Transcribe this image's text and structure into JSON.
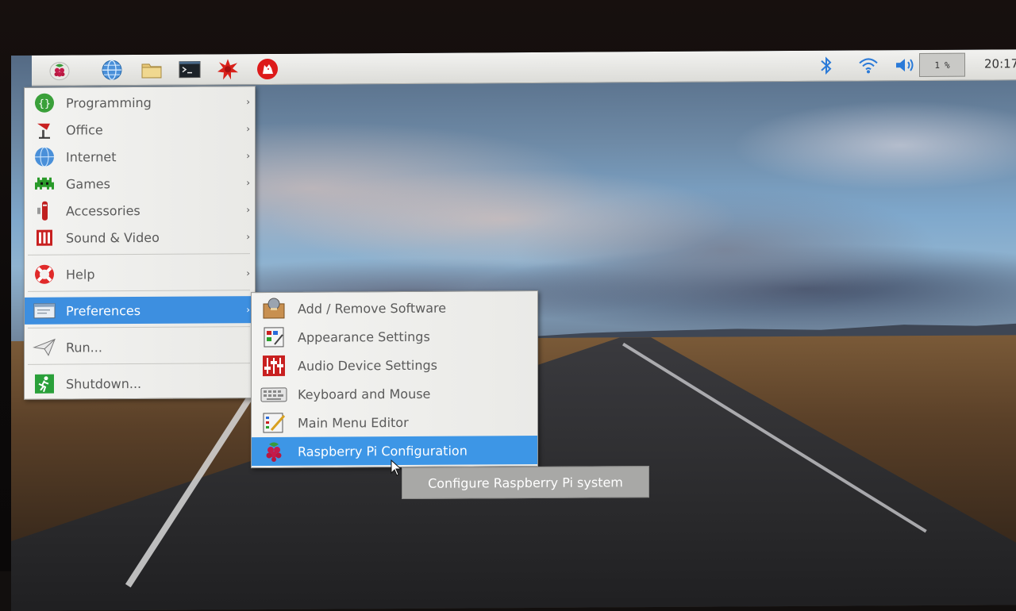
{
  "taskbar": {
    "launchers": [
      {
        "name": "menu-button",
        "icon": "raspberry-icon"
      },
      {
        "name": "web-browser",
        "icon": "globe-icon"
      },
      {
        "name": "file-manager",
        "icon": "folder-icon"
      },
      {
        "name": "terminal",
        "icon": "terminal-icon"
      },
      {
        "name": "mathematica",
        "icon": "star-burst-icon"
      },
      {
        "name": "wolfram",
        "icon": "wolf-icon"
      }
    ],
    "tray": {
      "cpu_label": "1",
      "cpu_unit": "%",
      "clock": "20:17"
    }
  },
  "menu": {
    "items": [
      {
        "label": "Programming",
        "icon": "programming-icon",
        "has_submenu": true
      },
      {
        "label": "Office",
        "icon": "office-icon",
        "has_submenu": true
      },
      {
        "label": "Internet",
        "icon": "globe-icon",
        "has_submenu": true
      },
      {
        "label": "Games",
        "icon": "games-icon",
        "has_submenu": true
      },
      {
        "label": "Accessories",
        "icon": "accessories-icon",
        "has_submenu": true
      },
      {
        "label": "Sound & Video",
        "icon": "sound-video-icon",
        "has_submenu": true
      },
      {
        "label": "Help",
        "icon": "help-lifebuoy-icon",
        "has_submenu": true
      },
      {
        "label": "Preferences",
        "icon": "preferences-icon",
        "has_submenu": true,
        "active": true
      },
      {
        "label": "Run...",
        "icon": "run-icon",
        "has_submenu": false
      },
      {
        "label": "Shutdown...",
        "icon": "shutdown-icon",
        "has_submenu": false
      }
    ]
  },
  "submenu": {
    "items": [
      {
        "label": "Add / Remove Software",
        "icon": "package-icon"
      },
      {
        "label": "Appearance Settings",
        "icon": "appearance-icon"
      },
      {
        "label": "Audio Device Settings",
        "icon": "audio-sliders-icon"
      },
      {
        "label": "Keyboard and Mouse",
        "icon": "keyboard-icon"
      },
      {
        "label": "Main Menu Editor",
        "icon": "menu-editor-icon"
      },
      {
        "label": "Raspberry Pi Configuration",
        "icon": "raspberry-icon",
        "active": true
      }
    ]
  },
  "tooltip": {
    "text": "Configure Raspberry Pi system"
  },
  "colors": {
    "highlight": "#3d8fe0",
    "panel": "#e8e8e6",
    "tooltip": "#a8a8a6"
  }
}
